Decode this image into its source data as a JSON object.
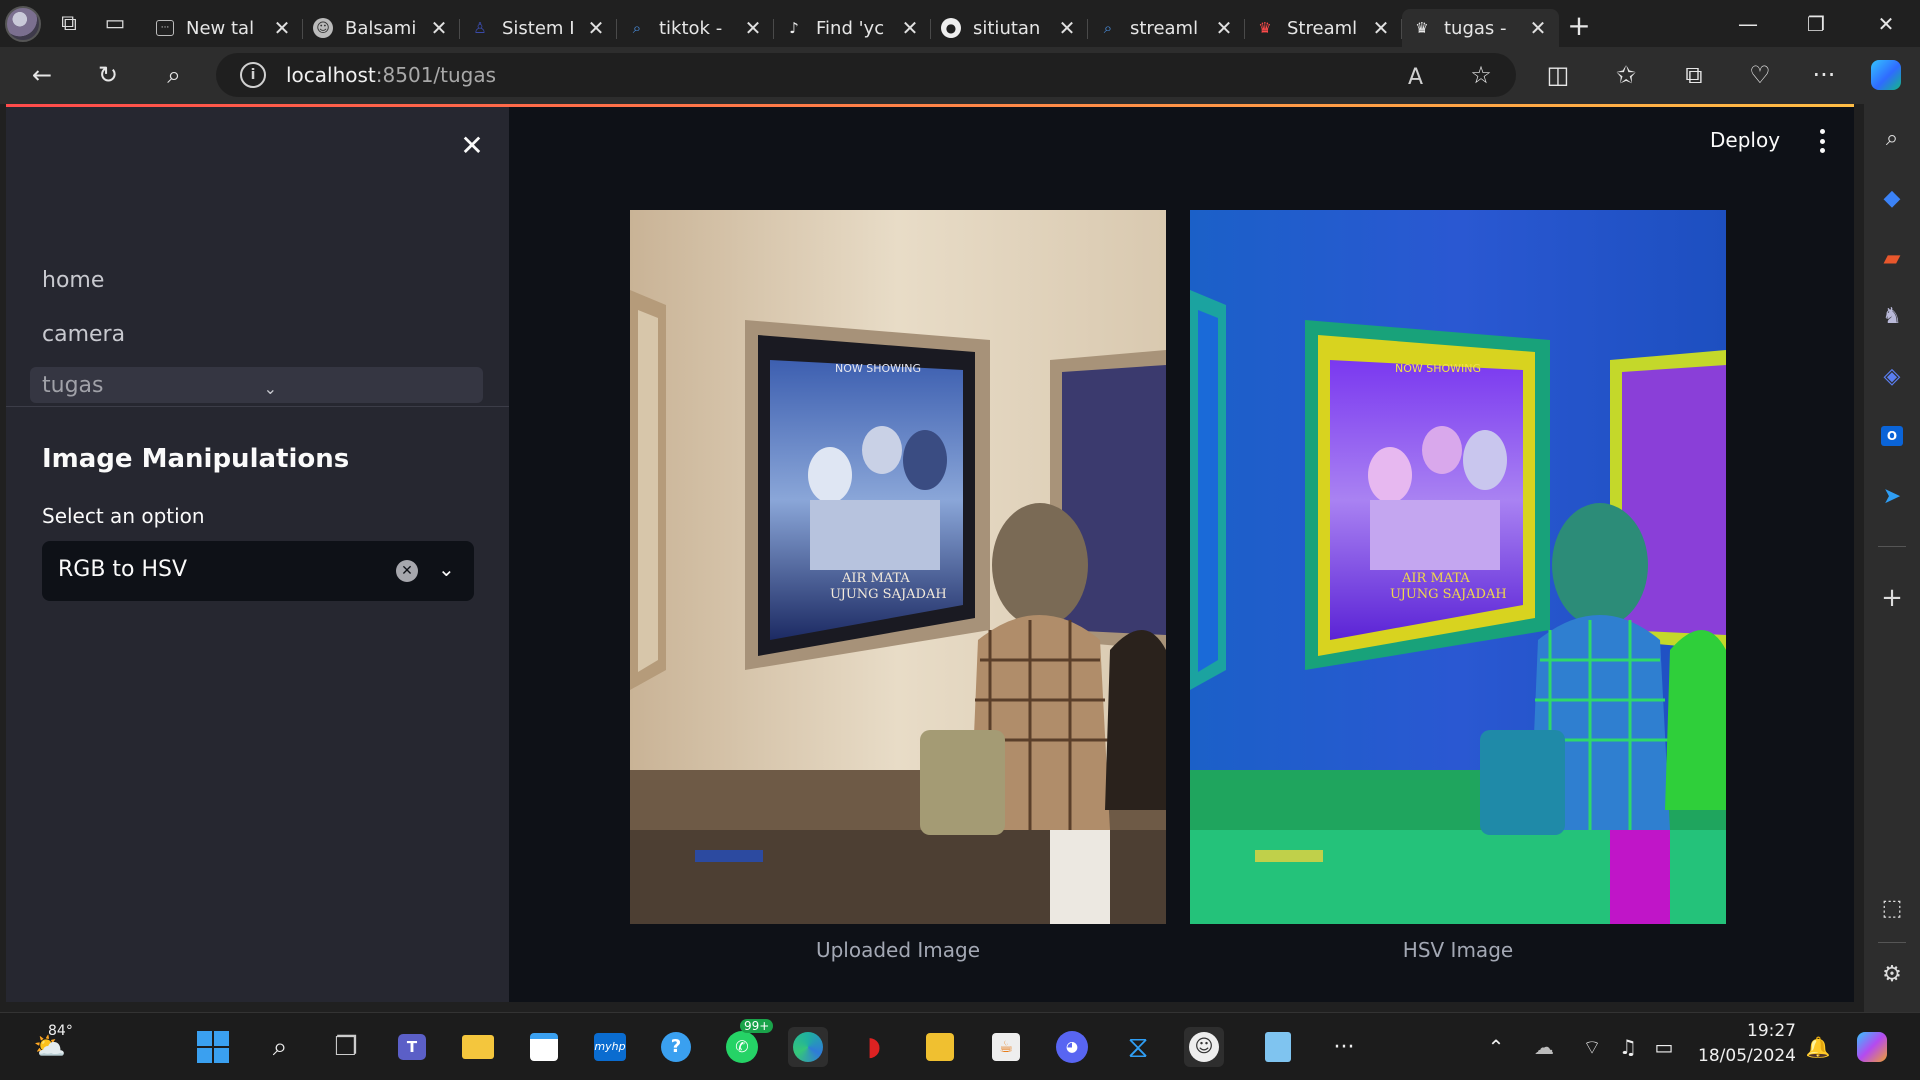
{
  "browser": {
    "tabs": [
      {
        "title": "New tal",
        "favicon": "newtab-icon"
      },
      {
        "title": "Balsami",
        "favicon": "balsamiq-icon"
      },
      {
        "title": "Sistem I",
        "favicon": "sistem-icon"
      },
      {
        "title": "tiktok -",
        "favicon": "search-icon"
      },
      {
        "title": "Find 'yc",
        "favicon": "tiktok-icon"
      },
      {
        "title": "sitiutan",
        "favicon": "github-icon"
      },
      {
        "title": "streaml",
        "favicon": "search-icon"
      },
      {
        "title": "Streaml",
        "favicon": "streamlit-icon"
      },
      {
        "title": "tugas -",
        "favicon": "streamlit-icon",
        "active": true
      }
    ],
    "address": {
      "host": "localhost",
      "rest": ":8501/tugas"
    }
  },
  "app": {
    "sidebar": {
      "nav": [
        {
          "label": "home"
        },
        {
          "label": "camera"
        },
        {
          "label": "tugas"
        }
      ],
      "header": "Image Manipulations",
      "select_label": "Select an option",
      "select_value": "RGB to HSV"
    },
    "toolbar": {
      "deploy_label": "Deploy"
    },
    "images": [
      {
        "caption": "Uploaded Image",
        "poster_now": "NOW SHOWING",
        "poster_title": "AIR MATA",
        "poster_title2": "UJUNG SAJADAH"
      },
      {
        "caption": "HSV Image",
        "poster_now": "NOW SHOWING",
        "poster_title": "AIR MATA",
        "poster_title2": "UJUNG SAJADAH"
      }
    ],
    "accent_gradient": [
      "#ff4b4b",
      "#ffbd45"
    ]
  },
  "taskbar": {
    "weather": "84°",
    "whatsapp_badge": "99+",
    "myhp_label": "myhp",
    "time": "19:27",
    "date": "18/05/2024"
  }
}
